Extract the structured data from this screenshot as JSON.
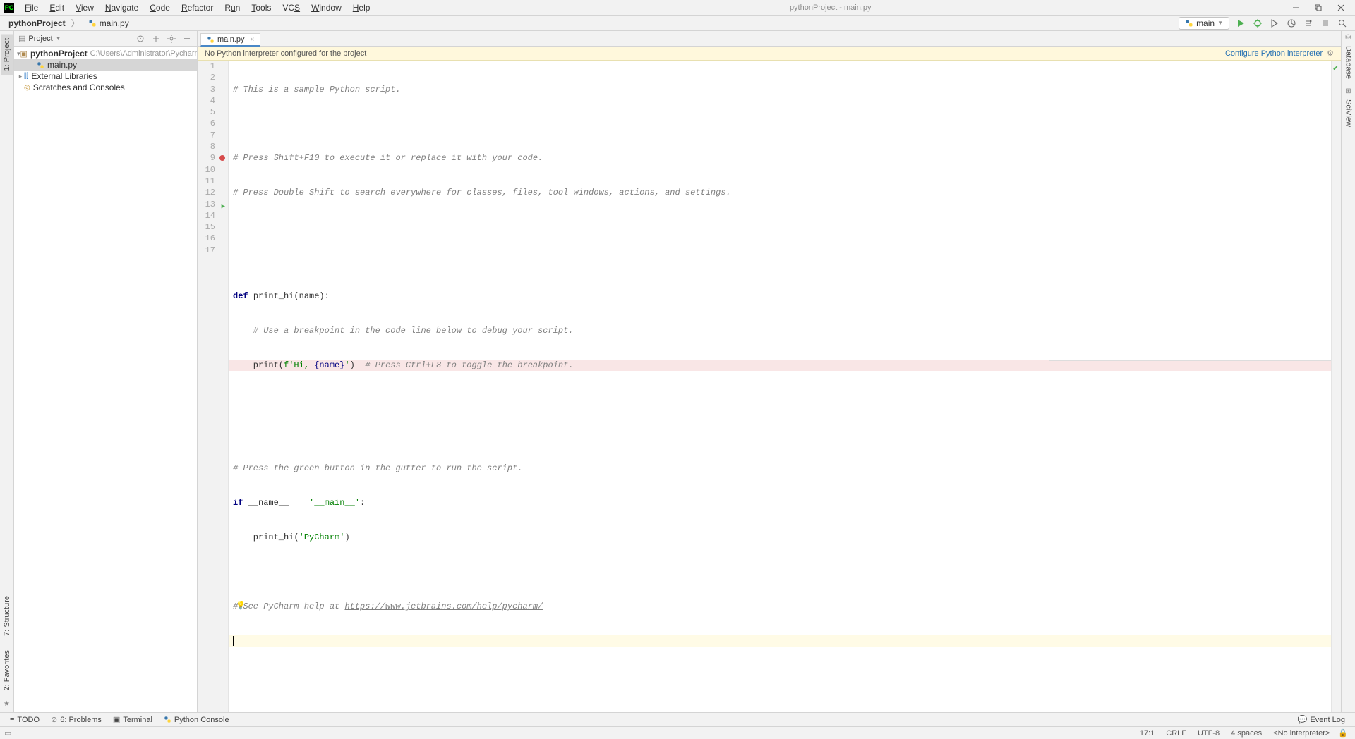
{
  "app": {
    "title": "pythonProject - main.py",
    "menus": [
      "File",
      "Edit",
      "View",
      "Navigate",
      "Code",
      "Refactor",
      "Run",
      "Tools",
      "VCS",
      "Window",
      "Help"
    ],
    "icon_text": "PC"
  },
  "breadcrumb": {
    "project": "pythonProject",
    "file": "main.py"
  },
  "run": {
    "config_name": "main"
  },
  "sidebar": {
    "title": "Project",
    "tree": {
      "root_name": "pythonProject",
      "root_path": "C:\\Users\\Administrator\\PycharmPr",
      "file": "main.py",
      "ext_lib": "External Libraries",
      "scratches": "Scratches and Consoles"
    }
  },
  "left_tabs": {
    "project": "1: Project",
    "structure": "7: Structure",
    "favorites": "2: Favorites"
  },
  "right_tabs": {
    "database": "Database",
    "sciview": "SciView"
  },
  "editor": {
    "tab_name": "main.py",
    "warning": "No Python interpreter configured for the project",
    "warning_link": "Configure Python interpreter",
    "lines": [
      {
        "n": 1
      },
      {
        "n": 2
      },
      {
        "n": 3
      },
      {
        "n": 4
      },
      {
        "n": 5
      },
      {
        "n": 6
      },
      {
        "n": 7
      },
      {
        "n": 8
      },
      {
        "n": 9
      },
      {
        "n": 10
      },
      {
        "n": 11
      },
      {
        "n": 12
      },
      {
        "n": 13
      },
      {
        "n": 14
      },
      {
        "n": 15
      },
      {
        "n": 16
      },
      {
        "n": 17
      }
    ],
    "code_text": {
      "l1": "# This is a sample Python script.",
      "l3": "# Press Shift+F10 to execute it or replace it with your code.",
      "l4": "# Press Double Shift to search everywhere for classes, files, tool windows, actions, and settings.",
      "l7_def": "def ",
      "l7_fn": "print_hi(name):",
      "l8": "    # Use a breakpoint in the code line below to debug your script.",
      "l9_a": "    print(",
      "l9_b": "f'Hi, ",
      "l9_c": "{name}",
      "l9_d": "'",
      "l9_e": ")  ",
      "l9_f": "# Press Ctrl+F8 to toggle the breakpoint.",
      "l12": "# Press the green button in the gutter to run the script.",
      "l13_a": "if ",
      "l13_b": "__name__ == ",
      "l13_c": "'__main__'",
      "l13_d": ":",
      "l14_a": "    print_hi(",
      "l14_b": "'PyCharm'",
      "l14_c": ")",
      "l16_a": "# See PyCharm help at ",
      "l16_b": "https://www.jetbrains.com/help/pycharm/"
    }
  },
  "bottom": {
    "todo": "TODO",
    "problems": "6: Problems",
    "terminal": "Terminal",
    "python_console": "Python Console",
    "event_log": "Event Log"
  },
  "status": {
    "pos": "17:1",
    "eol": "CRLF",
    "enc": "UTF-8",
    "indent": "4 spaces",
    "interpreter": "<No interpreter>"
  }
}
